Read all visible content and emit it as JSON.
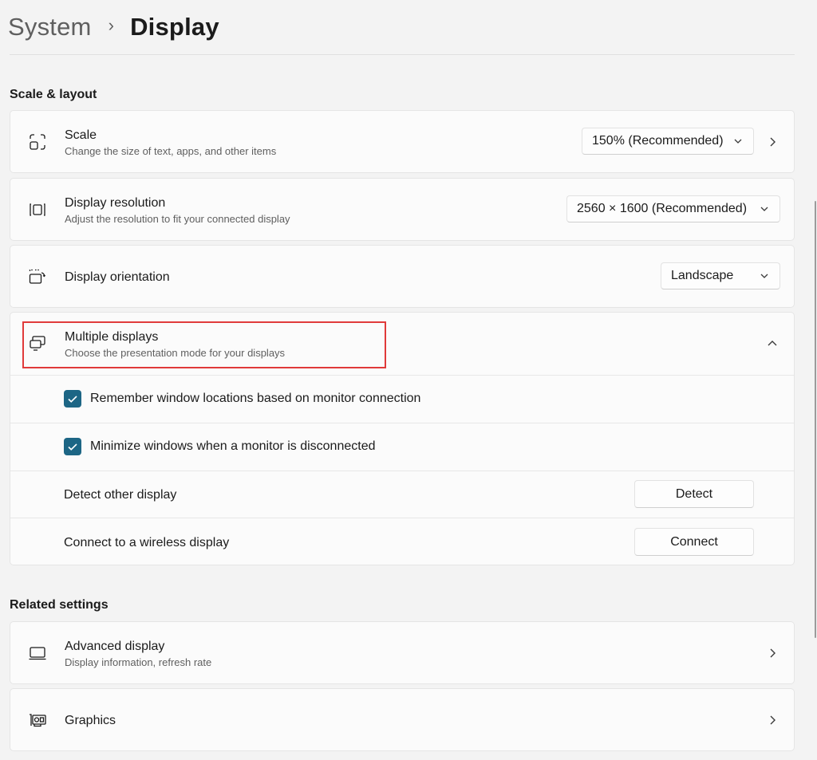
{
  "breadcrumb": {
    "parent": "System",
    "separator": "›",
    "current": "Display"
  },
  "sections": {
    "scale_layout": "Scale & layout",
    "related": "Related settings"
  },
  "scale": {
    "title": "Scale",
    "subtitle": "Change the size of text, apps, and other items",
    "value": "150% (Recommended)"
  },
  "resolution": {
    "title": "Display resolution",
    "subtitle": "Adjust the resolution to fit your connected display",
    "value": "2560 × 1600 (Recommended)"
  },
  "orientation": {
    "title": "Display orientation",
    "value": "Landscape"
  },
  "multiple_displays": {
    "title": "Multiple displays",
    "subtitle": "Choose the presentation mode for your displays",
    "expanded": true,
    "remember_label": "Remember window locations based on monitor connection",
    "remember_checked": true,
    "minimize_label": "Minimize windows when a monitor is disconnected",
    "minimize_checked": true,
    "detect_label": "Detect other display",
    "detect_button": "Detect",
    "connect_label": "Connect to a wireless display",
    "connect_button": "Connect"
  },
  "advanced": {
    "title": "Advanced display",
    "subtitle": "Display information, refresh rate"
  },
  "graphics": {
    "title": "Graphics"
  },
  "colors": {
    "accent": "#1d6685",
    "highlight": "#e03a3a",
    "background": "#f3f3f3",
    "card": "#fbfbfb"
  },
  "icons": {
    "scale": "scale-icon",
    "resolution": "resolution-icon",
    "orientation": "orientation-icon",
    "multiple_displays": "multiple-displays-icon",
    "advanced": "monitor-icon",
    "graphics": "graphics-card-icon"
  }
}
